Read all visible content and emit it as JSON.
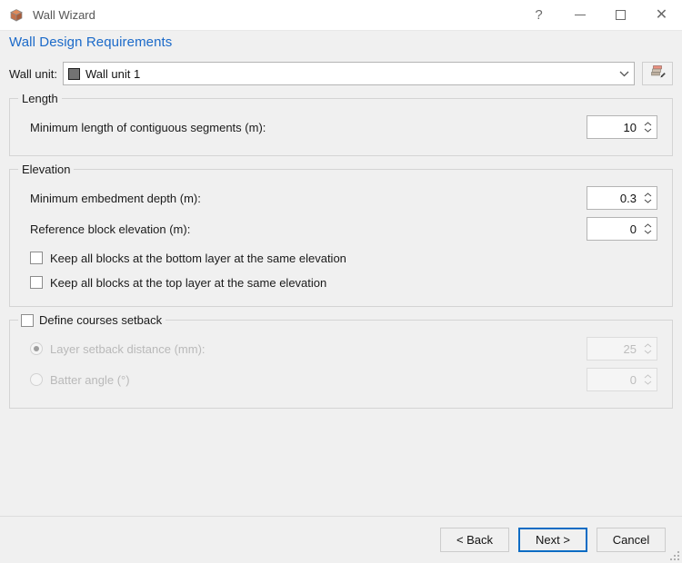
{
  "window": {
    "title": "Wall Wizard",
    "icon": "wall-block-icon",
    "controls": {
      "help": "?",
      "minimize": "—",
      "maximize": "□",
      "close": "✕"
    }
  },
  "header": {
    "title": "Wall Design Requirements"
  },
  "unit": {
    "label": "Wall unit:",
    "selected": "Wall unit 1",
    "swatch_color": "#737373",
    "edit_button_icon": "edit-wall-unit-icon"
  },
  "length_group": {
    "title": "Length",
    "min_length": {
      "label": "Minimum length of contiguous segments (m):",
      "value": "10"
    }
  },
  "elevation_group": {
    "title": "Elevation",
    "min_embedment": {
      "label": "Minimum embedment depth (m):",
      "value": "0.3"
    },
    "reference_elevation": {
      "label": "Reference block elevation (m):",
      "value": "0"
    },
    "keep_bottom": {
      "label": "Keep all blocks at the bottom layer at the same elevation",
      "checked": false
    },
    "keep_top": {
      "label": "Keep all blocks at the top layer at the same elevation",
      "checked": false
    }
  },
  "setback_group": {
    "title": "Define courses setback",
    "checked": false,
    "layer_setback": {
      "label": "Layer setback distance (mm):",
      "value": "25",
      "selected": true,
      "enabled": false
    },
    "batter_angle": {
      "label": "Batter angle (°)",
      "value": "0",
      "selected": false,
      "enabled": false
    }
  },
  "footer": {
    "back": "< Back",
    "next": "Next >",
    "cancel": "Cancel",
    "accent_color": "#0a6cc4"
  }
}
